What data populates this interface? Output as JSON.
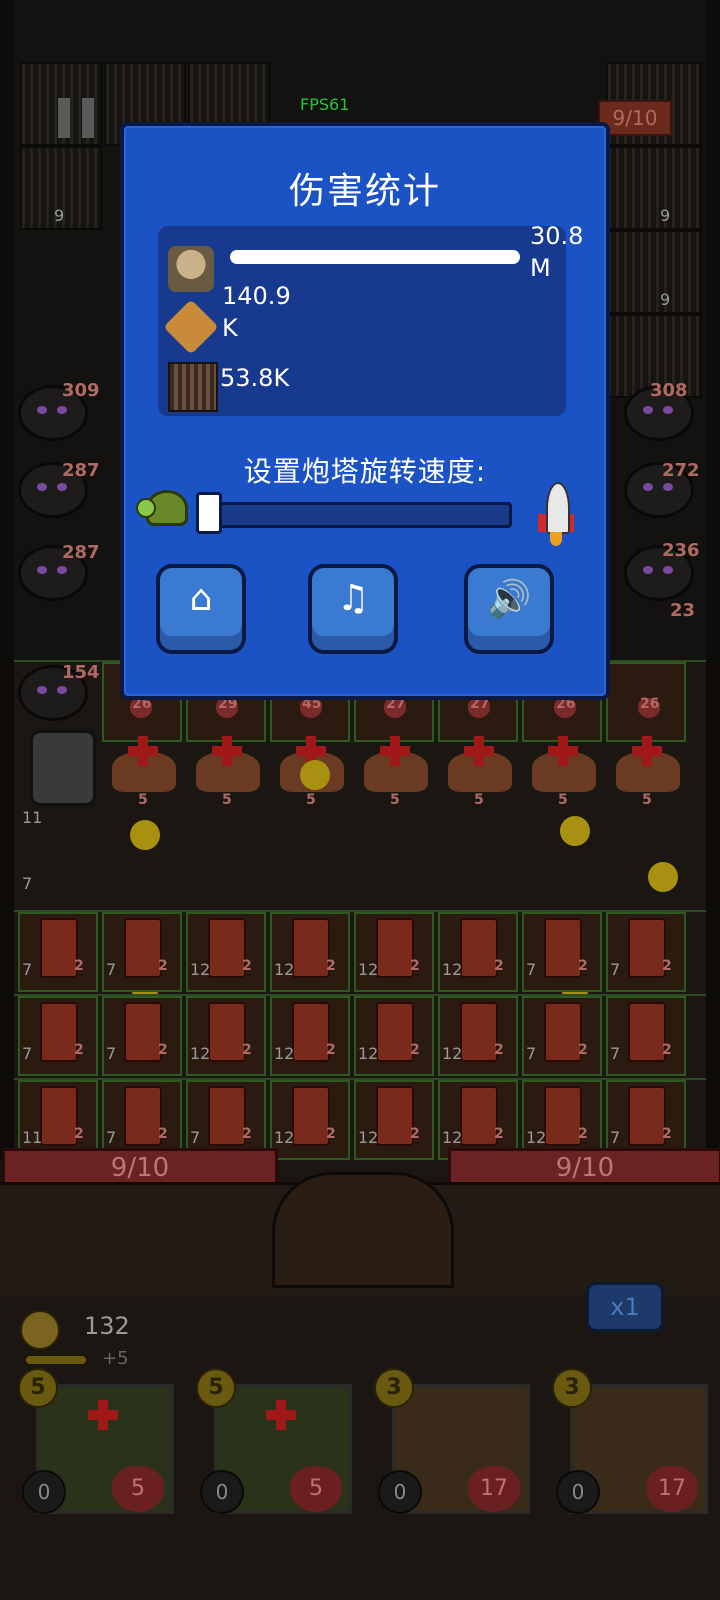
{
  "hud": {
    "fps": "FPS61",
    "wave_counter": "9/10"
  },
  "background_numbers": [
    "9",
    "9",
    "9"
  ],
  "enemies": [
    {
      "hp": "309"
    },
    {
      "hp": "287"
    },
    {
      "hp": "287"
    },
    {
      "hp": "154"
    },
    {
      "hp": "308"
    },
    {
      "hp": "272"
    },
    {
      "hp": "236"
    },
    {
      "hp": "23"
    }
  ],
  "turret_row_top": {
    "hp_values": [
      "26",
      "29",
      "45",
      "27",
      "27",
      "26",
      "26"
    ],
    "level_values": [
      "5",
      "5",
      "5",
      "5",
      "5",
      "5",
      "5"
    ]
  },
  "grid_rows": [
    {
      "levels": [
        "7",
        "7",
        "12",
        "12",
        "12",
        "12",
        "7",
        "7"
      ],
      "stars": [
        "2",
        "2",
        "2",
        "2",
        "2",
        "2",
        "2",
        "2"
      ]
    },
    {
      "levels": [
        "7",
        "7",
        "12",
        "12",
        "12",
        "12",
        "7",
        "7"
      ],
      "stars": [
        "2",
        "2",
        "2",
        "2",
        "2",
        "2",
        "2",
        "2"
      ]
    },
    {
      "levels": [
        "11",
        "7",
        "7",
        "12",
        "12",
        "12",
        "12",
        "7"
      ],
      "stars": [
        "2",
        "2",
        "2",
        "2",
        "2",
        "2",
        "2",
        "2"
      ]
    }
  ],
  "left_column_levels": [
    "11",
    "7"
  ],
  "gates": {
    "left": "9/10",
    "right": "9/10"
  },
  "speed_multiplier": "x1",
  "coins": {
    "amount": "132",
    "income": "+5"
  },
  "cards": [
    {
      "cost": "5",
      "count": "0",
      "hp": "5"
    },
    {
      "cost": "5",
      "count": "0",
      "hp": "5"
    },
    {
      "cost": "3",
      "count": "0",
      "hp": "17"
    },
    {
      "cost": "3",
      "count": "0",
      "hp": "17"
    }
  ],
  "dialog": {
    "title": "伤害统计",
    "stats": [
      {
        "value_line1": "30.8",
        "value_line2": "M",
        "bar_fraction": 1.0
      },
      {
        "value_line1": "140.9",
        "value_line2": "K"
      },
      {
        "value_line1": "53.8K"
      }
    ],
    "speed_label": "设置炮塔旋转速度:",
    "speed_slider_fraction": 0.0,
    "buttons": {
      "home": "home",
      "music": "music",
      "sound": "sound"
    }
  }
}
